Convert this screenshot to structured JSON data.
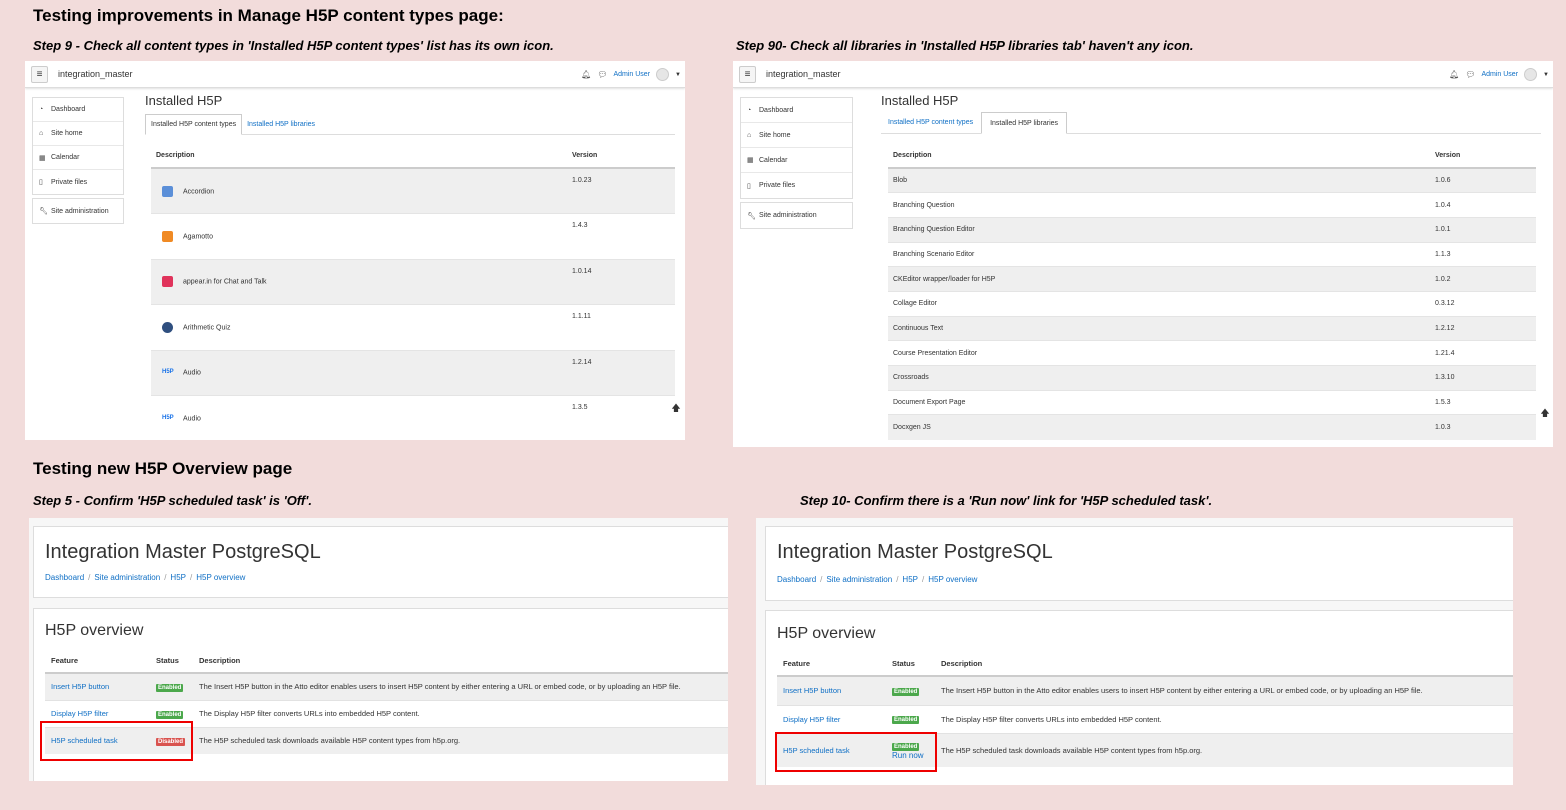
{
  "section1_title": "Testing improvements in Manage H5P content types page:",
  "step9": "Step 9 - Check all content types in 'Installed H5P content types' list has its own icon.",
  "step90": "Step 90- Check all libraries in 'Installed H5P libraries tab' haven't any icon.",
  "section2_title": "Testing new H5P Overview page",
  "step5": "Step 5 - Confirm 'H5P scheduled task' is 'Off'.",
  "step10": "Step 10- Confirm there is a 'Run now' link for 'H5P scheduled task'.",
  "moodle": {
    "site_name": "integration_master",
    "user": "Admin User",
    "nav": [
      "Dashboard",
      "Site home",
      "Calendar",
      "Private files"
    ],
    "site_admin": "Site administration",
    "page_title": "Installed H5P",
    "tab_types": "Installed H5P content types",
    "tab_libraries": "Installed H5P libraries",
    "col_description": "Description",
    "col_version": "Version"
  },
  "content_types": [
    {
      "name": "Accordion",
      "version": "1.0.23",
      "icon": "accordion-icon",
      "color": "#5b8fd8"
    },
    {
      "name": "Agamotto",
      "version": "1.4.3",
      "icon": "agamotto-icon",
      "color": "#f08a24"
    },
    {
      "name": "appear.in for Chat and Talk",
      "version": "1.0.14",
      "icon": "appear-in-icon",
      "color": "#e0335b"
    },
    {
      "name": "Arithmetic Quiz",
      "version": "1.1.11",
      "icon": "arithmetic-quiz-icon",
      "color": "#2f4f7f"
    },
    {
      "name": "Audio",
      "version": "1.2.14",
      "icon": "h5p-icon",
      "color": "#1a73e8"
    },
    {
      "name": "Audio",
      "version": "1.3.5",
      "icon": "h5p-icon",
      "color": "#1a73e8"
    }
  ],
  "libraries": [
    {
      "name": "Blob",
      "version": "1.0.6"
    },
    {
      "name": "Branching Question",
      "version": "1.0.4"
    },
    {
      "name": "Branching Question Editor",
      "version": "1.0.1"
    },
    {
      "name": "Branching Scenario Editor",
      "version": "1.1.3"
    },
    {
      "name": "CKEditor wrapper/loader for H5P",
      "version": "1.0.2"
    },
    {
      "name": "Collage Editor",
      "version": "0.3.12"
    },
    {
      "name": "Continuous Text",
      "version": "1.2.12"
    },
    {
      "name": "Course Presentation Editor",
      "version": "1.21.4"
    },
    {
      "name": "Crossroads",
      "version": "1.3.10"
    },
    {
      "name": "Document Export Page",
      "version": "1.5.3"
    },
    {
      "name": "Docxgen JS",
      "version": "1.0.3"
    }
  ],
  "overview": {
    "site_title": "Integration Master PostgreSQL",
    "breadcrumbs": [
      "Dashboard",
      "Site administration",
      "H5P",
      "H5P overview"
    ],
    "heading": "H5P overview",
    "col_feature": "Feature",
    "col_status": "Status",
    "col_description": "Description",
    "rows_left": [
      {
        "feature": "Insert H5P button",
        "status": "Enabled",
        "description": "The Insert H5P button in the Atto editor enables users to insert H5P content by either entering a URL or embed code, or by uploading an H5P file."
      },
      {
        "feature": "Display H5P filter",
        "status": "Enabled",
        "description": "The Display H5P filter converts URLs into embedded H5P content."
      },
      {
        "feature": "H5P scheduled task",
        "status": "Disabled",
        "description": "The H5P scheduled task downloads available H5P content types from h5p.org."
      }
    ],
    "rows_right": [
      {
        "feature": "Insert H5P button",
        "status": "Enabled",
        "description": "The Insert H5P button in the Atto editor enables users to insert H5P content by either entering a URL or embed code, or by uploading an H5P file."
      },
      {
        "feature": "Display H5P filter",
        "status": "Enabled",
        "description": "The Display H5P filter converts URLs into embedded H5P content."
      },
      {
        "feature": "H5P scheduled task",
        "status": "Enabled",
        "description": "The H5P scheduled task downloads available H5P content types from h5p.org."
      }
    ],
    "run_now": "Run now"
  },
  "colors": {
    "enabled": "#4ca84c",
    "disabled": "#d9534f",
    "link": "#0f6fc5",
    "highlight": "#e00000"
  }
}
